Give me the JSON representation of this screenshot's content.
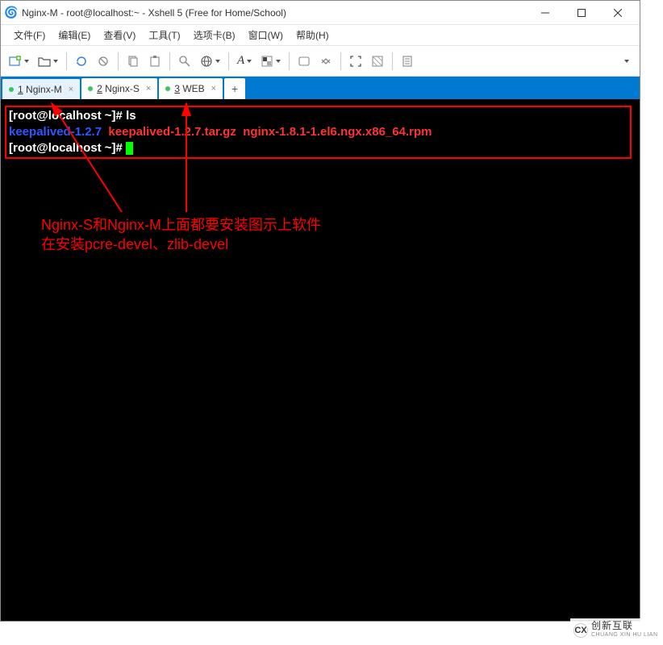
{
  "titlebar": {
    "title": "Nginx-M - root@localhost:~ - Xshell 5 (Free for Home/School)"
  },
  "menu": {
    "file": "文件(F)",
    "edit": "编辑(E)",
    "view": "查看(V)",
    "tools": "工具(T)",
    "tabs": "选项卡(B)",
    "window": "窗口(W)",
    "help": "帮助(H)"
  },
  "tabs": {
    "t1": "Nginx-M",
    "t2": "Nginx-S",
    "t3": "WEB"
  },
  "terminal": {
    "line1_prompt": "[root@localhost ~]# ",
    "line1_cmd": "ls",
    "line2_dir": "keepalived-1.2.7",
    "line2_file1": "keepalived-1.2.7.tar.gz",
    "line2_file2": "nginx-1.8.1-1.el6.ngx.x86_64.rpm",
    "line3_prompt": "[root@localhost ~]# "
  },
  "annotation": {
    "line1": "Nginx-S和Nginx-M上面都要安装图示上软件",
    "line2": "在安装pcre-devel、zlib-devel"
  },
  "watermark": {
    "cn": "创新互联",
    "en": "CHUANG XIN HU LIAN"
  }
}
